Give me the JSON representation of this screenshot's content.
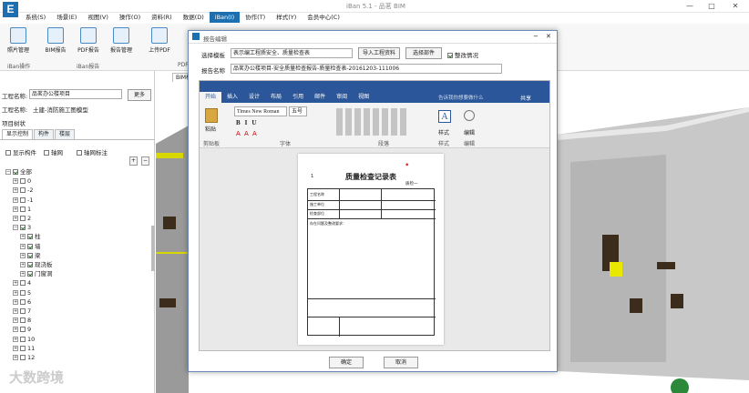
{
  "app": {
    "title": "iBan 5.1 - 品茗 BIM",
    "win_min": "—",
    "win_max": "□",
    "win_close": "✕"
  },
  "menu": [
    "系统(S)",
    "场景(E)",
    "视图(V)",
    "操作(O)",
    "资料(R)",
    "数据(D)",
    "iBan(I)",
    "协作(T)",
    "样式(Y)",
    "会员中心(C)"
  ],
  "menu_active": 6,
  "ribbon": {
    "buttons": [
      "照片管理",
      "BIM报告",
      "PDF报告",
      "报告管理",
      "上传PDF"
    ],
    "groups": [
      "iBan操作",
      "iBan报告",
      "PDF"
    ]
  },
  "left_panel": {
    "project_label": "工程名称:",
    "project_value": "品茗办公楼项目",
    "more_button": "更多",
    "model_label": "工程名称:",
    "model_value": "土建-消防施工图模型",
    "project_root": "项目树状",
    "tabs": [
      "显示控制",
      "构件",
      "楼层"
    ],
    "filters": [
      "显示构件",
      "轴网",
      "轴网标注"
    ],
    "plus": "+",
    "minus": "−",
    "tree": [
      {
        "label": "全部",
        "level": 0,
        "checked": true,
        "exp": "−"
      },
      {
        "label": "0",
        "level": 1,
        "checked": false,
        "exp": "+"
      },
      {
        "label": "-2",
        "level": 1,
        "checked": false,
        "exp": "+"
      },
      {
        "label": "-1",
        "level": 1,
        "checked": false,
        "exp": "+"
      },
      {
        "label": "1",
        "level": 1,
        "checked": false,
        "exp": "+"
      },
      {
        "label": "2",
        "level": 1,
        "checked": false,
        "exp": "+"
      },
      {
        "label": "3",
        "level": 1,
        "checked": true,
        "exp": "−"
      },
      {
        "label": "柱",
        "level": 2,
        "checked": true,
        "exp": "+"
      },
      {
        "label": "墙",
        "level": 2,
        "checked": true,
        "exp": "+"
      },
      {
        "label": "梁",
        "level": 2,
        "checked": true,
        "exp": "+"
      },
      {
        "label": "现浇板",
        "level": 2,
        "checked": true,
        "exp": "+"
      },
      {
        "label": "门窗洞",
        "level": 2,
        "checked": true,
        "exp": "+"
      },
      {
        "label": "4",
        "level": 1,
        "checked": false,
        "exp": "+"
      },
      {
        "label": "5",
        "level": 1,
        "checked": false,
        "exp": "+"
      },
      {
        "label": "6",
        "level": 1,
        "checked": false,
        "exp": "+"
      },
      {
        "label": "7",
        "level": 1,
        "checked": false,
        "exp": "+"
      },
      {
        "label": "8",
        "level": 1,
        "checked": false,
        "exp": "+"
      },
      {
        "label": "9",
        "level": 1,
        "checked": false,
        "exp": "+"
      },
      {
        "label": "10",
        "level": 1,
        "checked": false,
        "exp": "+"
      },
      {
        "label": "11",
        "level": 1,
        "checked": false,
        "exp": "+"
      },
      {
        "label": "12",
        "level": 1,
        "checked": false,
        "exp": "+"
      }
    ]
  },
  "viewport": {
    "tab": "BIM模型"
  },
  "dialog": {
    "title": "报告编辑",
    "template_label": "选择模板",
    "template_value": "表示编工程质安全、质量检查表",
    "import_button": "导入工程资料",
    "select_button": "选择部件",
    "check_label": "整改情况",
    "name_label": "报告名称",
    "name_value": "品茗办公楼项目-安全质量检查报告-质量检查表-20161203-111006",
    "ok": "确定",
    "cancel": "取消"
  },
  "word": {
    "tabs": [
      "开始",
      "插入",
      "设计",
      "布局",
      "引用",
      "邮件",
      "审阅",
      "视图"
    ],
    "tell_me": "告诉我你想要做什么",
    "share": "共享",
    "font": "Times New Roman",
    "size": "五号",
    "groups": [
      "剪贴板",
      "字体",
      "段落",
      "样式",
      "编辑"
    ],
    "paste": "粘贴",
    "styles": "样式",
    "editing": "编辑"
  },
  "document": {
    "title": "质量检查记录表",
    "header_left": "1",
    "header_right": "质检一",
    "rows": [
      "工程名称",
      "施工单位",
      "检查部位",
      "存在问题及整改要求："
    ]
  },
  "watermark": "大数跨境"
}
